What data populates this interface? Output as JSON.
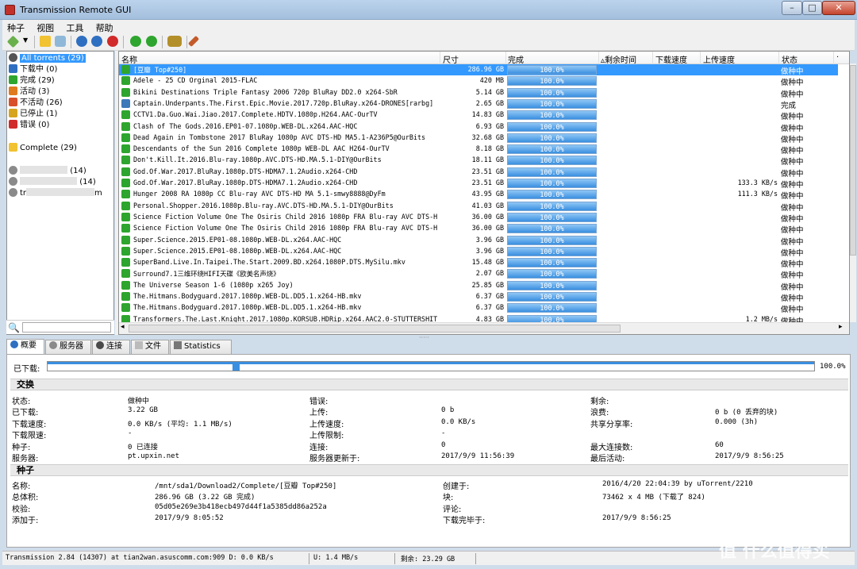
{
  "window": {
    "title": "Transmission Remote GUI"
  },
  "menu": [
    "种子",
    "视图",
    "工具",
    "帮助"
  ],
  "sidebar": {
    "filters": [
      {
        "label": "All torrents  (29)",
        "icon": "all-torrents-icon",
        "color": "#555555"
      },
      {
        "label": "下载中  (0)",
        "icon": "download-icon",
        "color": "#2f6fc1"
      },
      {
        "label": "完成  (29)",
        "icon": "complete-icon",
        "color": "#2ea52e"
      },
      {
        "label": "活动  (3)",
        "icon": "active-icon",
        "color": "#e07a1e"
      },
      {
        "label": "不活动  (26)",
        "icon": "inactive-icon",
        "color": "#d94f2a"
      },
      {
        "label": "已停止  (1)",
        "icon": "stopped-icon",
        "color": "#d6a51e"
      },
      {
        "label": "错误  (0)",
        "icon": "error-icon",
        "color": "#d12a2a"
      }
    ],
    "folders": [
      {
        "label": "Complete  (29)"
      }
    ],
    "trackers": [
      {
        "label": "(14)"
      },
      {
        "label": "(14)"
      },
      {
        "label": "tr"
      },
      {
        "label": "m"
      }
    ]
  },
  "grid": {
    "columns": [
      "名称",
      "尺寸",
      "完成",
      "剩余时间",
      "下载速度",
      "上传速度",
      "状态"
    ],
    "rows": [
      {
        "name": "[豆瓣 Top#250]",
        "size": "286.96 GB",
        "done": "100.0%",
        "up": "",
        "status": "做种中",
        "selected": true,
        "icon": "seeding"
      },
      {
        "name": "Adele - 25 CD Orginal 2015-FLAC",
        "size": "420 MB",
        "done": "100.0%",
        "up": "",
        "status": "做种中",
        "icon": "seeding"
      },
      {
        "name": "Bikini Destinations Triple Fantasy 2006 720p BluRay DD2.0 x264-SbR",
        "size": "5.14 GB",
        "done": "100.0%",
        "up": "",
        "status": "做种中",
        "icon": "seeding"
      },
      {
        "name": "Captain.Underpants.The.First.Epic.Movie.2017.720p.BluRay.x264-DRONES[rarbg]",
        "size": "2.65 GB",
        "done": "100.0%",
        "up": "",
        "status": "完成",
        "icon": "done"
      },
      {
        "name": "CCTV1.Da.Guo.Wai.Jiao.2017.Complete.HDTV.1080p.H264.AAC-OurTV",
        "size": "14.83 GB",
        "done": "100.0%",
        "up": "",
        "status": "做种中",
        "icon": "seeding"
      },
      {
        "name": "Clash of The Gods.2016.EP01-07.1080p.WEB-DL.x264.AAC-HQC",
        "size": "6.93 GB",
        "done": "100.0%",
        "up": "",
        "status": "做种中",
        "icon": "seeding"
      },
      {
        "name": "Dead Again in Tombstone 2017 BluRay 1080p AVC DTS-HD MA5.1-A236P5@OurBits",
        "size": "32.68 GB",
        "done": "100.0%",
        "up": "",
        "status": "做种中",
        "icon": "seeding"
      },
      {
        "name": "Descendants of the Sun 2016 Complete 1080p WEB-DL AAC H264-OurTV",
        "size": "8.18 GB",
        "done": "100.0%",
        "up": "",
        "status": "做种中",
        "icon": "seeding"
      },
      {
        "name": "Don't.Kill.It.2016.Blu-ray.1080p.AVC.DTS-HD.MA.5.1-DIY@OurBits",
        "size": "18.11 GB",
        "done": "100.0%",
        "up": "",
        "status": "做种中",
        "icon": "seeding"
      },
      {
        "name": "God.Of.War.2017.BluRay.1080p.DTS-HDMA7.1.2Audio.x264-CHD",
        "size": "23.51 GB",
        "done": "100.0%",
        "up": "",
        "status": "做种中",
        "icon": "seeding"
      },
      {
        "name": "God.Of.War.2017.BluRay.1080p.DTS-HDMA7.1.2Audio.x264-CHD",
        "size": "23.51 GB",
        "done": "100.0%",
        "up": "133.3 KB/s",
        "status": "做种中",
        "icon": "seeding"
      },
      {
        "name": "Hunger 2008 RA 1080p CC Blu-ray AVC DTS-HD MA 5.1-smwy8888@DyFm",
        "size": "43.95 GB",
        "done": "100.0%",
        "up": "111.3 KB/s",
        "status": "做种中",
        "icon": "seeding"
      },
      {
        "name": "Personal.Shopper.2016.1080p.Blu-ray.AVC.DTS-HD.MA.5.1-DIY@OurBits",
        "size": "41.03 GB",
        "done": "100.0%",
        "up": "",
        "status": "做种中",
        "icon": "seeding"
      },
      {
        "name": "Science Fiction Volume One The Osiris Child 2016 1080p FRA Blu-ray AVC DTS-H",
        "size": "36.00 GB",
        "done": "100.0%",
        "up": "",
        "status": "做种中",
        "icon": "seeding"
      },
      {
        "name": "Science Fiction Volume One The Osiris Child 2016 1080p FRA Blu-ray AVC DTS-H",
        "size": "36.00 GB",
        "done": "100.0%",
        "up": "",
        "status": "做种中",
        "icon": "seeding"
      },
      {
        "name": "Super.Science.2015.EP01-08.1080p.WEB-DL.x264.AAC-HQC",
        "size": "3.96 GB",
        "done": "100.0%",
        "up": "",
        "status": "做种中",
        "icon": "seeding"
      },
      {
        "name": "Super.Science.2015.EP01-08.1080p.WEB-DL.x264.AAC-HQC",
        "size": "3.96 GB",
        "done": "100.0%",
        "up": "",
        "status": "做种中",
        "icon": "seeding"
      },
      {
        "name": "SuperBand.Live.In.Taipei.The.Start.2009.BD.x264.1080P.DTS.MySilu.mkv",
        "size": "15.48 GB",
        "done": "100.0%",
        "up": "",
        "status": "做种中",
        "icon": "seeding"
      },
      {
        "name": "Surround7.1三维环绕HIFI天碟《欧美名声烧》",
        "size": "2.07 GB",
        "done": "100.0%",
        "up": "",
        "status": "做种中",
        "icon": "seeding"
      },
      {
        "name": "The Universe Season 1-6 (1080p x265 Joy)",
        "size": "25.85 GB",
        "done": "100.0%",
        "up": "",
        "status": "做种中",
        "icon": "seeding"
      },
      {
        "name": "The.Hitmans.Bodyguard.2017.1080p.WEB-DL.DD5.1.x264-HB.mkv",
        "size": "6.37 GB",
        "done": "100.0%",
        "up": "",
        "status": "做种中",
        "icon": "seeding"
      },
      {
        "name": "The.Hitmans.Bodyguard.2017.1080p.WEB-DL.DD5.1.x264-HB.mkv",
        "size": "6.37 GB",
        "done": "100.0%",
        "up": "",
        "status": "做种中",
        "icon": "seeding"
      },
      {
        "name": "Transformers.The.Last.Knight.2017.1080p.KORSUB.HDRip.x264.AAC2.0-STUTTERSHIT",
        "size": "4.83 GB",
        "done": "100.0%",
        "up": "1.2 MB/s",
        "status": "做种中",
        "icon": "seeding"
      }
    ]
  },
  "tabs": [
    "概要",
    "服务器",
    "连接",
    "文件",
    "Statistics"
  ],
  "details": {
    "downloaded_label": "已下载:",
    "downloaded_pct": "100.0%",
    "downloaded_fraction": 1.0,
    "section_transfer": "交换",
    "section_torrent": "种子",
    "transfer": [
      {
        "label": "状态:",
        "value": "做种中"
      },
      {
        "label": "已下载:",
        "value": "3.22 GB"
      },
      {
        "label": "下载速度:",
        "value": "0.0 KB/s (平均: 1.1 MB/s)"
      },
      {
        "label": "下载限速:",
        "value": "-"
      },
      {
        "label": "种子:",
        "value": "0 已连接"
      },
      {
        "label": "服务器:",
        "value": "pt.upxin.net"
      }
    ],
    "transfer_mid": [
      {
        "label": "错误:",
        "value": ""
      },
      {
        "label": "上传:",
        "value": "0 b"
      },
      {
        "label": "上传速度:",
        "value": "0.0 KB/s"
      },
      {
        "label": "上传限制:",
        "value": "-"
      },
      {
        "label": "连接:",
        "value": "0"
      },
      {
        "label": "服务器更新于:",
        "value": "2017/9/9 11:56:39"
      }
    ],
    "transfer_right": [
      {
        "label": "剩余:",
        "value": ""
      },
      {
        "label": "浪费:",
        "value": "0 b (0 丢弃的块)"
      },
      {
        "label": "共享分享率:",
        "value": "0.000 (3h)"
      },
      {
        "label": "",
        "value": ""
      },
      {
        "label": "最大连接数:",
        "value": "60"
      },
      {
        "label": "最后活动:",
        "value": "2017/9/9 8:56:25"
      }
    ],
    "torrent_left": [
      {
        "label": "名称:",
        "value": "/mnt/sda1/Download2/Complete/[豆瓣 Top#250]"
      },
      {
        "label": "总体积:",
        "value": "286.96 GB (3.22 GB 完成)"
      },
      {
        "label": "校验:",
        "value": "05d05e269e3b418ecb497d44f1a5385dd86a252a"
      },
      {
        "label": "添加于:",
        "value": "2017/9/9 8:05:52"
      }
    ],
    "torrent_right": [
      {
        "label": "创建于:",
        "value": "2016/4/20 22:04:39 by uTorrent/2210"
      },
      {
        "label": "块:",
        "value": "73462 x 4 MB (下载了 824)"
      },
      {
        "label": "评论:",
        "value": ""
      },
      {
        "label": "下载完毕于:",
        "value": "2017/9/9 8:56:25"
      }
    ]
  },
  "statusbar": {
    "left": "Transmission 2.84 (14307) at tian2wan.asuscomm.com:909 D: 0.0 KB/s",
    "up": "U: 1.4 MB/s",
    "remaining": "剩余: 23.29 GB"
  },
  "watermark": "值 什么值得买"
}
